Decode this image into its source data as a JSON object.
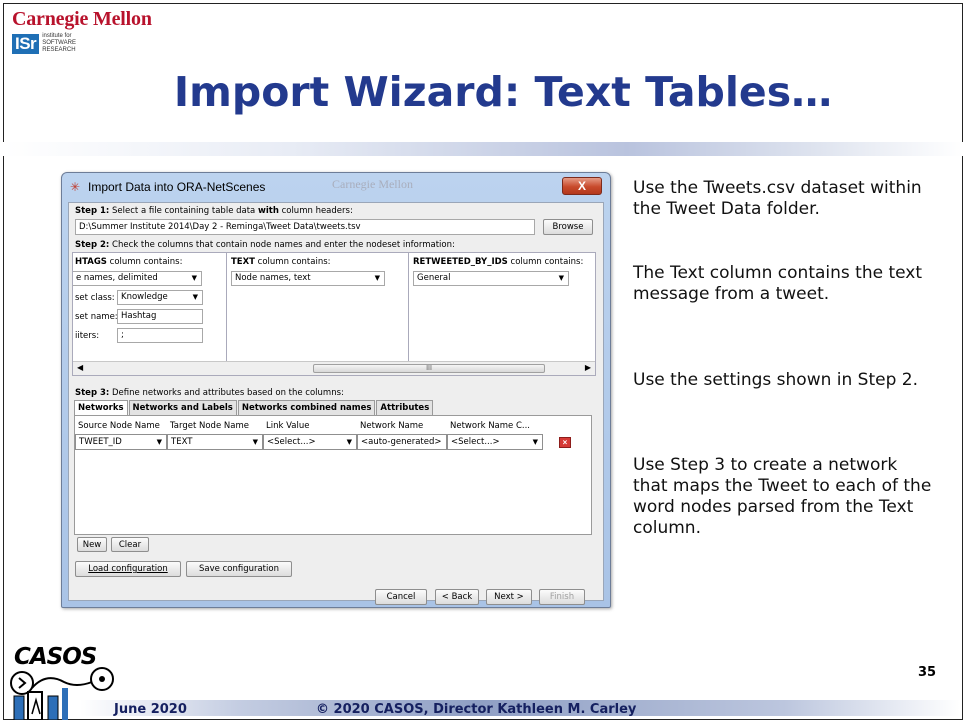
{
  "slide": {
    "brand": "Carnegie Mellon",
    "isr_logo": {
      "abbr": "ISr",
      "sub_lines": [
        "institute for",
        "SOFTWARE",
        "RESEARCH"
      ]
    },
    "title": "Import Wizard: Text Tables…",
    "page_number": "35",
    "footer": {
      "date": "June 2020",
      "copyright": "© 2020 CASOS, Director Kathleen M. Carley"
    },
    "casos_logo": "CASOS"
  },
  "dialog": {
    "title": "Import Data into ORA-NetScenes",
    "background_text": "Carnegie Mellon",
    "close_glyph": "X",
    "step1": {
      "label_bold": "Step 1:",
      "label_pre": " Select a file containing table data ",
      "label_bold2": "with",
      "label_post": " column headers:",
      "path": "D:\\Summer Institute 2014\\Day 2 - Reminga\\Tweet Data\\tweets.tsv",
      "browse_label": "Browse"
    },
    "step2": {
      "label_bold": "Step 2:",
      "label_rest": " Check the columns that contain node names and enter the nodeset information:",
      "columns": [
        {
          "header_bold": "HTAGS",
          "header_rest": " column contains:",
          "type_value": "e names, delimited",
          "rows": [
            {
              "label": "set class:",
              "value": "Knowledge",
              "kind": "combo"
            },
            {
              "label": "set name:",
              "value": "Hashtag",
              "kind": "text"
            },
            {
              "label": "iiters:",
              "value": ";",
              "kind": "text"
            }
          ]
        },
        {
          "header_bold": "TEXT",
          "header_rest": " column contains:",
          "type_value": "Node names, text"
        },
        {
          "header_bold": "RETWEETED_BY_IDS",
          "header_rest": " column contains:",
          "type_value": "General"
        }
      ],
      "scroll_thumb": "III"
    },
    "step3": {
      "label_bold": "Step 3:",
      "label_rest": " Define networks and attributes based on the columns:",
      "tabs": [
        "Networks",
        "Networks and Labels",
        "Networks combined names",
        "Attributes"
      ],
      "grid_headers": [
        "Source Node Name",
        "Target Node Name",
        "Link Value",
        "Network Name",
        "Network Name C..."
      ],
      "grid_row": [
        "TWEET_ID",
        "TEXT",
        "<Select...>",
        "<auto-generated>",
        "<Select...>"
      ],
      "new_label": "New",
      "clear_label": "Clear"
    },
    "load_config": "Load configuration",
    "save_config": "Save configuration",
    "nav": {
      "cancel": "Cancel",
      "back": "< Back",
      "next": "Next >",
      "finish": "Finish"
    }
  },
  "notes": [
    "Use the Tweets.csv dataset within the Tweet Data folder.",
    "The Text column contains the text message from a tweet.",
    "Use the settings shown in Step 2.",
    "Use Step 3 to create a network that maps the Tweet to each of the word nodes parsed from the Text column."
  ],
  "colors": {
    "title": "#233a8e",
    "brand": "#b8122c",
    "footer_text": "#152060",
    "close_button": "#c84a2c"
  }
}
